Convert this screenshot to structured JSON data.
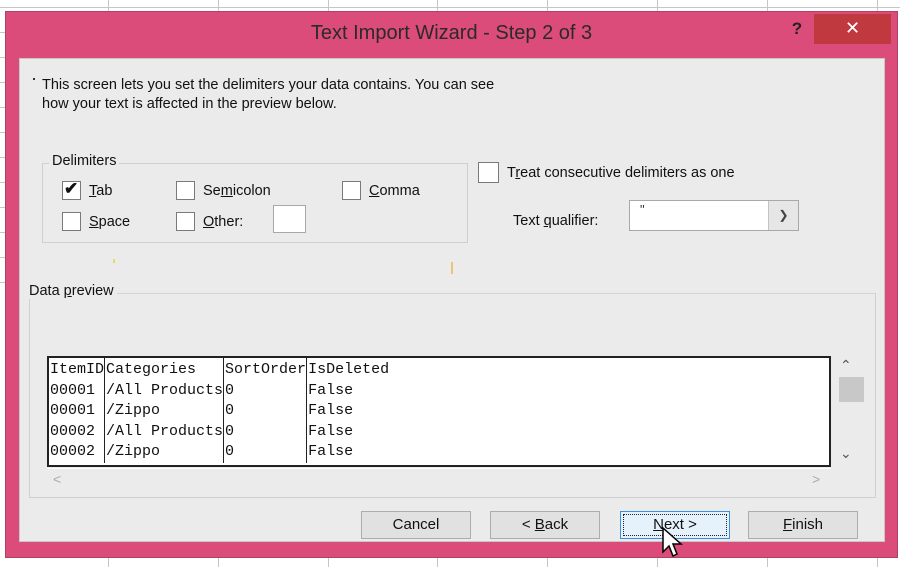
{
  "dialog": {
    "title": "Text Import Wizard - Step 2 of 3",
    "help_label": "?",
    "close_label": "✕",
    "colors": {
      "frame": "#dc4c7a",
      "close_bg": "#c0393f",
      "client_bg": "#ebebeb"
    }
  },
  "description": {
    "line1": "This screen lets you set the delimiters your data contains.  You can see",
    "line2": "how your text is affected in the preview below."
  },
  "delimiters": {
    "group_label": "Delimiters",
    "options": [
      {
        "pre": "",
        "key": "T",
        "post": "ab",
        "checked": true
      },
      {
        "pre": "Se",
        "key": "m",
        "post": "icolon",
        "checked": false
      },
      {
        "pre": "",
        "key": "C",
        "post": "omma",
        "checked": false
      },
      {
        "pre": "",
        "key": "S",
        "post": "pace",
        "checked": false
      },
      {
        "pre": "",
        "key": "O",
        "post": "ther:",
        "checked": false
      }
    ],
    "other_value": ""
  },
  "consecutive": {
    "pre": "T",
    "key": "r",
    "post": "eat consecutive delimiters as one",
    "checked": false
  },
  "text_qualifier": {
    "pre": "Text ",
    "key": "q",
    "post": "ualifier:",
    "selected": "\""
  },
  "preview": {
    "group_pre": "Data ",
    "group_key": "p",
    "group_post": "review",
    "rows": [
      [
        "ItemID",
        "Categories",
        "SortOrder",
        "IsDeleted"
      ],
      [
        "00001",
        "/All Products",
        "0",
        "False"
      ],
      [
        "00001",
        "/Zippo",
        "0",
        "False"
      ],
      [
        "00002",
        "/All Products",
        "0",
        "False"
      ],
      [
        "00002",
        "/Zippo",
        "0",
        "False"
      ]
    ]
  },
  "buttons": {
    "cancel": {
      "label": "Cancel"
    },
    "back": {
      "pre": "< ",
      "key": "B",
      "post": "ack"
    },
    "next": {
      "pre": "",
      "key": "N",
      "post": "ext >"
    },
    "finish": {
      "pre": "",
      "key": "F",
      "post": "inish"
    }
  }
}
